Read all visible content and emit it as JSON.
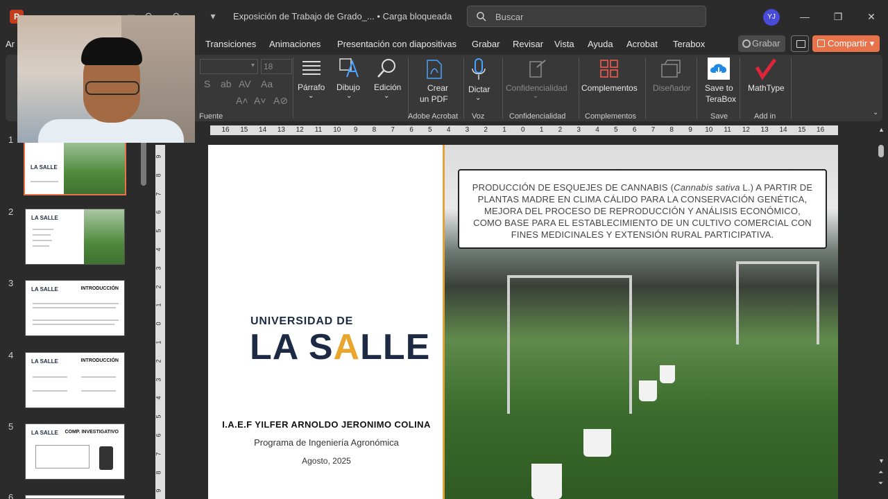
{
  "window": {
    "document_title": "Exposición de Trabajo de Grado_... • Carga bloqueada",
    "search_placeholder": "Buscar",
    "user_initials": "YJ"
  },
  "menu": {
    "tabs": [
      "Transiciones",
      "Animaciones",
      "Presentación con diapositivas",
      "Grabar",
      "Revisar",
      "Vista",
      "Ayuda",
      "Acrobat",
      "Terabox"
    ],
    "partial_tab": "Ar",
    "grabar_button": "Grabar",
    "share_button": "Compartir"
  },
  "ribbon": {
    "font_size": "18",
    "groups": {
      "fuente": "Fuente",
      "adobe": "Adobe Acrobat",
      "voz": "Voz",
      "conf": "Confidencialidad",
      "comp": "Complementos",
      "save": "Save",
      "addin": "Add in"
    },
    "buttons": {
      "parrafo": "Párrafo",
      "dibujo": "Dibujo",
      "edicion": "Edición",
      "crear_pdf_1": "Crear",
      "crear_pdf_2": "un PDF",
      "dictar": "Dictar",
      "confidencialidad": "Confidencialidad",
      "complementos": "Complementos",
      "disenador": "Diseñador",
      "save_terabox_1": "Save to",
      "save_terabox_2": "TeraBox",
      "mathtype": "MathType"
    }
  },
  "thumbnails": [
    {
      "number": "1",
      "logo": "LA SALLE",
      "title": ""
    },
    {
      "number": "2",
      "logo": "LA SALLE",
      "title": ""
    },
    {
      "number": "3",
      "logo": "LA SALLE",
      "title": "INTRODUCCIÓN"
    },
    {
      "number": "4",
      "logo": "LA SALLE",
      "title": "INTRODUCCIÓN"
    },
    {
      "number": "5",
      "logo": "LA SALLE",
      "title": "COMP. INVESTIGATIVO"
    },
    {
      "number": "6",
      "logo": "",
      "title": ""
    }
  ],
  "ruler": {
    "h_labels": [
      "16",
      "15",
      "14",
      "13",
      "12",
      "11",
      "10",
      "9",
      "8",
      "7",
      "6",
      "5",
      "4",
      "3",
      "2",
      "1",
      "0",
      "1",
      "2",
      "3",
      "4",
      "5",
      "6",
      "7",
      "8",
      "9",
      "10",
      "11",
      "12",
      "13",
      "14",
      "15",
      "16"
    ],
    "v_labels": [
      "9",
      "8",
      "7",
      "6",
      "5",
      "4",
      "3",
      "2",
      "1",
      "0",
      "1",
      "2",
      "3",
      "4",
      "5",
      "6",
      "7",
      "8",
      "9"
    ]
  },
  "slide": {
    "title_text": "PRODUCCIÓN DE ESQUEJES DE CANNABIS (Cannabis sativa L.) A PARTIR DE PLANTAS MADRE EN CLIMA CÁLIDO PARA LA CONSERVACIÓN GENÉTICA, MEJORA DEL PROCESO DE REPRODUCCIÓN Y ANÁLISIS ECONÓMICO, COMO BASE PARA EL ESTABLECIMIENTO DE UN CULTIVO COMERCIAL CON FINES MEDICINALES Y EXTENSIÓN RURAL PARTICIPATIVA.",
    "university_small": "UNIVERSIDAD DE",
    "university_big_1": "LA S",
    "university_big_a": "A",
    "university_big_2": "LLE",
    "author": "I.A.E.F YILFER ARNOLDO JERONIMO COLINA",
    "program": "Programa de Ingeniería Agronómica",
    "date": "Agosto, 2025"
  },
  "colors": {
    "share": "#e8734a",
    "ppt_logo": "#c43e1c",
    "brand_navy": "#1d2a44",
    "brand_gold": "#e8a62e"
  }
}
